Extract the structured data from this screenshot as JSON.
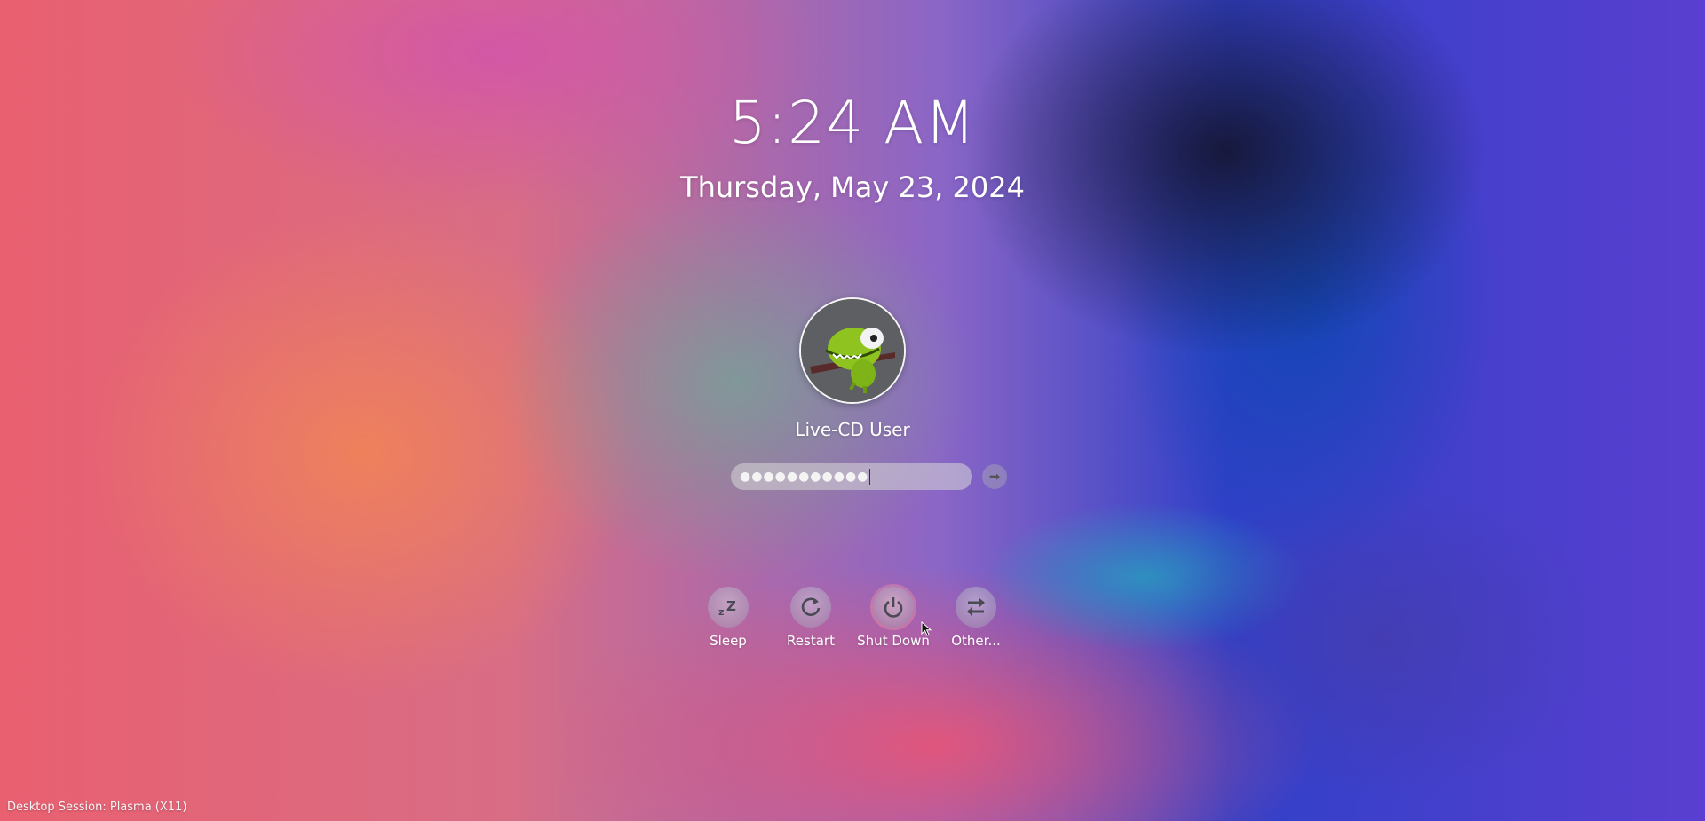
{
  "lockscreen": {
    "time": "5:24 AM",
    "date": "Thursday, May 23, 2024",
    "user": {
      "name": "Live-CD User",
      "avatar_icon": "chameleon-avatar-icon"
    },
    "password": {
      "masked_value": "●●●●●●●●●●●",
      "submit_icon": "arrow-right-icon"
    },
    "actions": [
      {
        "label": "Sleep",
        "icon": "sleep-icon"
      },
      {
        "label": "Restart",
        "icon": "restart-icon"
      },
      {
        "label": "Shut Down",
        "icon": "power-icon"
      },
      {
        "label": "Other...",
        "icon": "switch-user-icon"
      }
    ],
    "session": "Desktop Session: Plasma (X11)"
  }
}
